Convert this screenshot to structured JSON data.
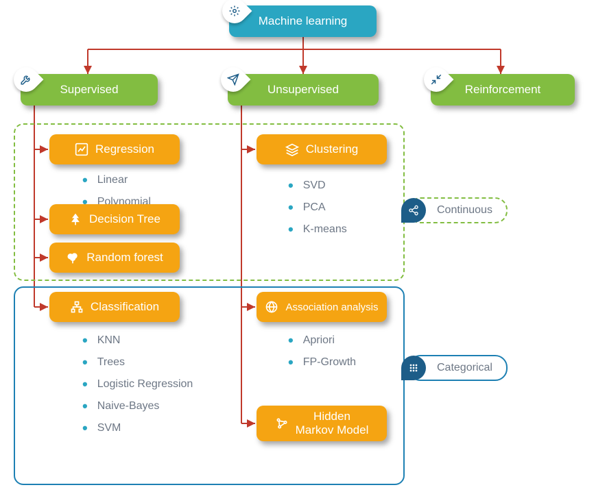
{
  "root": {
    "label": "Machine learning"
  },
  "branches": {
    "supervised": "Supervised",
    "unsupervised": "Unsupervised",
    "reinforcement": "Reinforcement"
  },
  "supervised": {
    "regression": {
      "label": "Regression",
      "items": [
        "Linear",
        "Polynomial"
      ]
    },
    "decision_tree": {
      "label": "Decision Tree"
    },
    "random_forest": {
      "label": "Random forest"
    },
    "classification": {
      "label": "Classification",
      "items": [
        "KNN",
        "Trees",
        "Logistic Regression",
        "Naive-Bayes",
        "SVM"
      ]
    }
  },
  "unsupervised": {
    "clustering": {
      "label": "Clustering",
      "items": [
        "SVD",
        "PCA",
        "K-means"
      ]
    },
    "association": {
      "label": "Association analysis",
      "items": [
        "Apriori",
        "FP-Growth"
      ]
    },
    "hmm": {
      "label": "Hidden\nMarkov Model"
    }
  },
  "groups": {
    "continuous": "Continuous",
    "categorical": "Categorical"
  },
  "colors": {
    "teal": "#2aa6c2",
    "green": "#82bd41",
    "orange": "#f5a412",
    "arrow": "#c0392b",
    "blue": "#1d80b3"
  }
}
